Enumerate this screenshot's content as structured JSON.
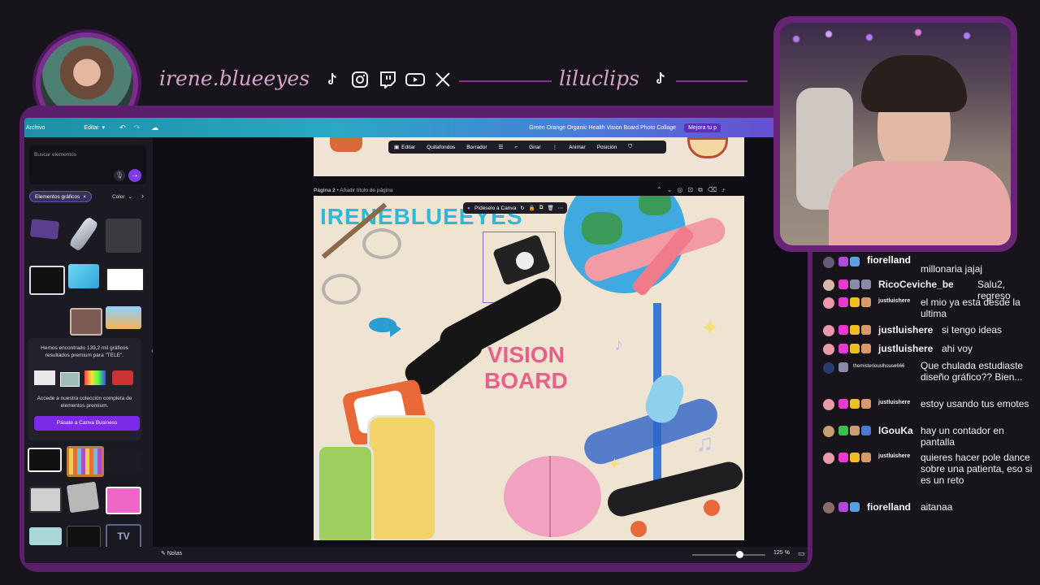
{
  "overlay": {
    "handle": "irene.blueeyes",
    "clip_handle": "liluclips",
    "socials": [
      "tiktok-icon",
      "instagram-icon",
      "twitch-icon",
      "youtube-icon",
      "x-icon"
    ]
  },
  "canva": {
    "menu_file": "Archivo",
    "menu_edit": "Editar",
    "design_title": "Green Orange Organic Health Vision Board Photo Collage",
    "upgrade": "Mejora tu p",
    "search_placeholder": "Buscar elementos",
    "filter_chip": "Elementos gráficos",
    "filter_color": "Color",
    "premium_text": "Hemos encontrado 139,2 mil gráficos resultados premium para \"TELE\".",
    "premium_access": "Accede a nuestra colección completa de elementos premium.",
    "premium_button": "Pásate a Canva Business",
    "toolbar": [
      "Editar",
      "Quitafondos",
      "Borrador",
      "Girar",
      "Animar",
      "Posición"
    ],
    "page2_label": "Página 2",
    "page2_title_hint": "Añadir título de página",
    "float_action": "Pídeselo a Canva",
    "board_title": "IRENEBLUEEYES",
    "vision_line1": "VISION",
    "vision_line2": "BOARD",
    "notes": "Notas",
    "zoom": "125 %",
    "tv_label": "TV"
  },
  "chat": [
    {
      "user": "fiorelland",
      "text": "millonaria jajaj",
      "color": "#ffffff"
    },
    {
      "user": "RicoCeviche_be",
      "text": "Salu2, regreso",
      "color": "#ffffff"
    },
    {
      "user": "justluishere",
      "text": "el mio ya esta desde la ultima",
      "color": "#ffffff",
      "small": true
    },
    {
      "user": "justluishere",
      "text": "si tengo ideas",
      "color": "#ffffff"
    },
    {
      "user": "justluishere",
      "text": "ahi voy",
      "color": "#ffffff"
    },
    {
      "user": "themisteriouslhouse666",
      "text": "Que chulada estudiaste diseño gráfico?? Bien...",
      "color": "#ffffff",
      "small": true
    },
    {
      "user": "justluishere",
      "text": "estoy usando tus emotes",
      "color": "#ffffff",
      "small": true
    },
    {
      "user": "lGouKa",
      "text": "hay un contador en pantalla",
      "color": "#ffffff"
    },
    {
      "user": "justluishere",
      "text": "quieres hacer pole dance sobre una patienta, eso si es un reto",
      "color": "#ffffff",
      "small": true
    },
    {
      "user": "fiorelland",
      "text": "aitanaa",
      "color": "#ffffff"
    }
  ]
}
